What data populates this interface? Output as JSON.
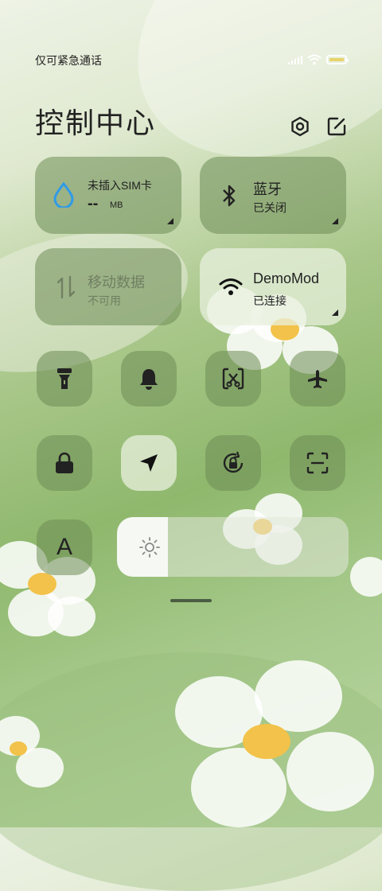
{
  "status_bar": {
    "carrier": "仅可紧急通话",
    "battery_color": "#e7d46a"
  },
  "title": "控制中心",
  "tiles": {
    "data": {
      "label": "未插入SIM卡",
      "value": "--",
      "unit": "MB"
    },
    "bluetooth": {
      "label": "蓝牙",
      "status": "已关闭"
    },
    "mobile": {
      "label": "移动数据",
      "status": "不可用"
    },
    "wifi": {
      "label": "DemoMod",
      "status": "已连接"
    }
  },
  "toggles": [
    {
      "name": "flashlight-icon",
      "active": false
    },
    {
      "name": "bell-icon",
      "active": false
    },
    {
      "name": "screenshot-icon",
      "active": false
    },
    {
      "name": "airplane-icon",
      "active": false
    },
    {
      "name": "lock-icon",
      "active": false
    },
    {
      "name": "location-icon",
      "active": true
    },
    {
      "name": "rotation-lock-icon",
      "active": false
    },
    {
      "name": "scan-icon",
      "active": false
    }
  ],
  "font_button": {
    "label": "A"
  },
  "brightness": {
    "level": 0.22
  },
  "colors": {
    "water_icon": "#2f9be8",
    "tile_dark": "#6e8c55",
    "tile_light": "#e8f0de"
  }
}
